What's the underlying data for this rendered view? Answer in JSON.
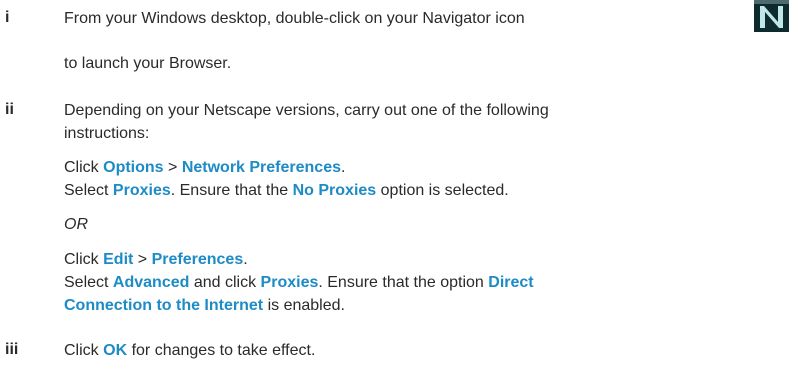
{
  "steps": [
    {
      "num": "i",
      "line1": "From your Windows desktop, double-click on your Navigator icon",
      "line2": "to launch your Browser.",
      "icon": "netscape-navigator-icon"
    },
    {
      "num": "ii",
      "line1": "Depending on your Netscape versions, carry out one of the following",
      "line2": "instructions:",
      "optA": {
        "click_prefix": "Click",
        "menu1": "Options",
        "sep": ">",
        "menu2": "Network Preferences",
        "end": ".",
        "select_prefix": "Select",
        "tab": "Proxies",
        "mid": ". Ensure that the",
        "option": "No Proxies",
        "suffix": "option is selected."
      },
      "or": "OR",
      "optB": {
        "click_prefix": "Click",
        "menu1": "Edit",
        "sep": ">",
        "menu2": "Preferences",
        "end": ".",
        "select_prefix": "Select",
        "cat": "Advanced",
        "and_click": "and click",
        "tab": "Proxies",
        "mid": ". Ensure that the option",
        "option_part1": "Direct",
        "option_part2": "Connection to the Internet",
        "suffix": "is enabled."
      }
    },
    {
      "num": "iii",
      "click": "Click",
      "button": "OK",
      "rest": "for changes to take effect."
    }
  ],
  "colors": {
    "keyword": "#1d8bc6",
    "text": "#2a2a2a"
  }
}
